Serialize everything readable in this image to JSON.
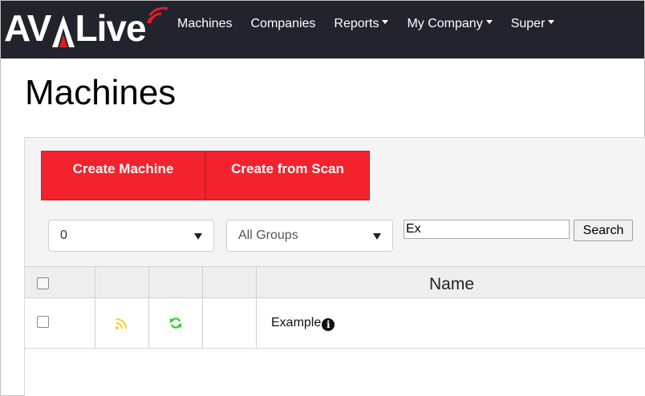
{
  "app": {
    "logo_text_left": "AV",
    "logo_text_right": "Live"
  },
  "nav": {
    "items": [
      {
        "label": "Machines",
        "dropdown": false
      },
      {
        "label": "Companies",
        "dropdown": false
      },
      {
        "label": "Reports",
        "dropdown": true
      },
      {
        "label": "My Company",
        "dropdown": true
      },
      {
        "label": "Super",
        "dropdown": true
      }
    ]
  },
  "page": {
    "title": "Machines"
  },
  "actions": {
    "create_machine": "Create Machine",
    "create_from_scan": "Create from Scan"
  },
  "filters": {
    "count_select": "0",
    "group_select": "All Groups",
    "search_value": "Ex",
    "search_button": "Search"
  },
  "table": {
    "headers": [
      "",
      "",
      "",
      "",
      "Name"
    ],
    "rows": [
      {
        "signal": "signal-icon-yellow",
        "sync": "sync-icon-green",
        "name": "Example"
      }
    ]
  },
  "colors": {
    "navbar": "#23232e",
    "accent_red": "#f4222d",
    "signal_yellow": "#f5d020",
    "sync_green": "#33cc33"
  }
}
